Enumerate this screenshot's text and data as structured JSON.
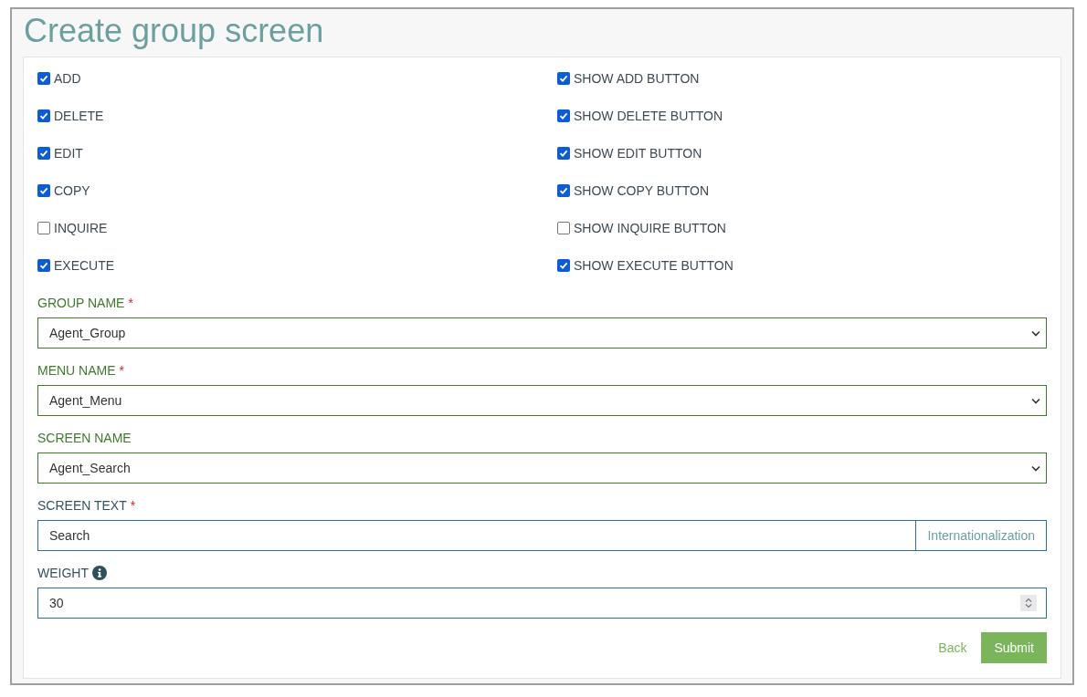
{
  "title": "Create group screen",
  "checkboxes": [
    {
      "label": "ADD",
      "checked": true
    },
    {
      "label": "SHOW ADD BUTTON",
      "checked": true
    },
    {
      "label": "DELETE",
      "checked": true
    },
    {
      "label": "SHOW DELETE BUTTON",
      "checked": true
    },
    {
      "label": "EDIT",
      "checked": true
    },
    {
      "label": "SHOW EDIT BUTTON",
      "checked": true
    },
    {
      "label": "COPY",
      "checked": true
    },
    {
      "label": "SHOW COPY BUTTON",
      "checked": true
    },
    {
      "label": "INQUIRE",
      "checked": false
    },
    {
      "label": "SHOW INQUIRE BUTTON",
      "checked": false
    },
    {
      "label": "EXECUTE",
      "checked": true
    },
    {
      "label": "SHOW EXECUTE BUTTON",
      "checked": true
    }
  ],
  "fields": [
    {
      "kind": "select",
      "label": "GROUP NAME",
      "required_mark": "*",
      "value": "Agent_Group"
    },
    {
      "kind": "select",
      "label": "MENU NAME",
      "required_mark": "*",
      "value": "Agent_Menu"
    },
    {
      "kind": "select",
      "label": "SCREEN NAME",
      "value": "Agent_Search"
    },
    {
      "kind": "text",
      "label": "SCREEN TEXT",
      "required_mark": "*",
      "value": "Search",
      "addon": "Internationalization"
    },
    {
      "kind": "number",
      "label": "WEIGHT",
      "info": true,
      "value": "30"
    }
  ],
  "buttons": {
    "back": "Back",
    "submit": "Submit"
  }
}
